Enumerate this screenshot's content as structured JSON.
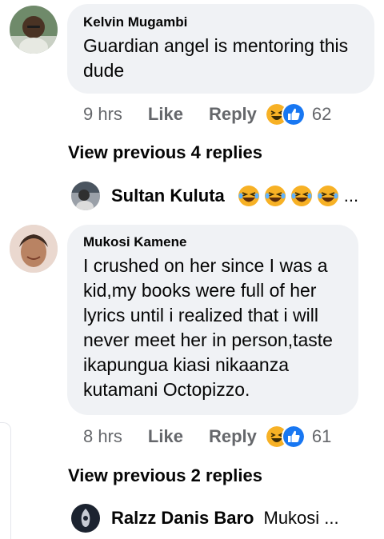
{
  "comments": [
    {
      "author": "Kelvin Mugambi",
      "text_lines": [
        "Guardian angel is mentoring this",
        "dude"
      ],
      "time": "9 hrs",
      "like_label": "Like",
      "reply_label": "Reply",
      "reaction_count": "62",
      "reactions": [
        "haha",
        "like"
      ],
      "view_previous": "View previous 4 replies",
      "reply_preview": {
        "name": "Sultan Kuluta",
        "emojis": [
          "laughing-emoji",
          "laughing-emoji",
          "laughing-emoji",
          "laughing-emoji"
        ],
        "ellipsis": "..."
      }
    },
    {
      "author": "Mukosi Kamene",
      "text_lines": [
        "I crushed on her since I was a",
        "kid,my books were full of her",
        "lyrics until i realized that i will",
        "never meet her in person,taste",
        "ikapungua kiasi nikaanza",
        "kutamani Octopizzo."
      ],
      "time": "8 hrs",
      "like_label": "Like",
      "reply_label": "Reply",
      "reaction_count": "61",
      "reactions": [
        "haha",
        "like"
      ],
      "view_previous": "View previous 2 replies",
      "reply_preview": {
        "name": "Ralzz Danis Baro",
        "snippet": "Mukosi ..."
      }
    }
  ],
  "colors": {
    "bubble": "#f0f2f5",
    "meta_text": "#65676b",
    "like_blue": "#1877f2",
    "haha_yellow": "#f7b125"
  }
}
